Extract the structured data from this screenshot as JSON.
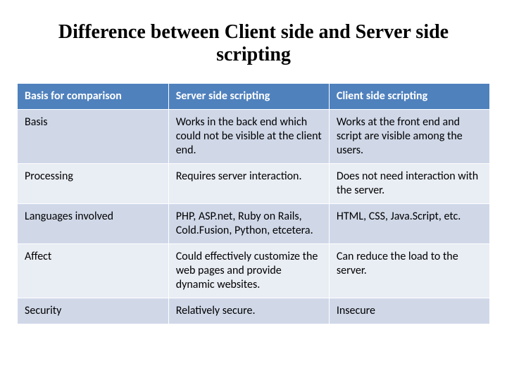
{
  "title": "Difference between Client side and Server side scripting",
  "table": {
    "headers": [
      "Basis for comparison",
      "Server side scripting",
      "Client side scripting"
    ],
    "rows": [
      {
        "label": "Basis",
        "server": "Works in the back end which could not be visible at the client end.",
        "client": "Works at the front end and script are visible among the users."
      },
      {
        "label": "Processing",
        "server": "Requires server interaction.",
        "client": "Does not need interaction with the server."
      },
      {
        "label": "Languages involved",
        "server": "PHP, ASP.net, Ruby on Rails, Cold.Fusion, Python, etcetera.",
        "client": "HTML, CSS, Java.Script, etc."
      },
      {
        "label": "Affect",
        "server": "Could effectively customize the web pages and provide dynamic websites.",
        "client": "Can reduce the load to the server."
      },
      {
        "label": "Security",
        "server": "Relatively secure.",
        "client": "Insecure"
      }
    ]
  }
}
